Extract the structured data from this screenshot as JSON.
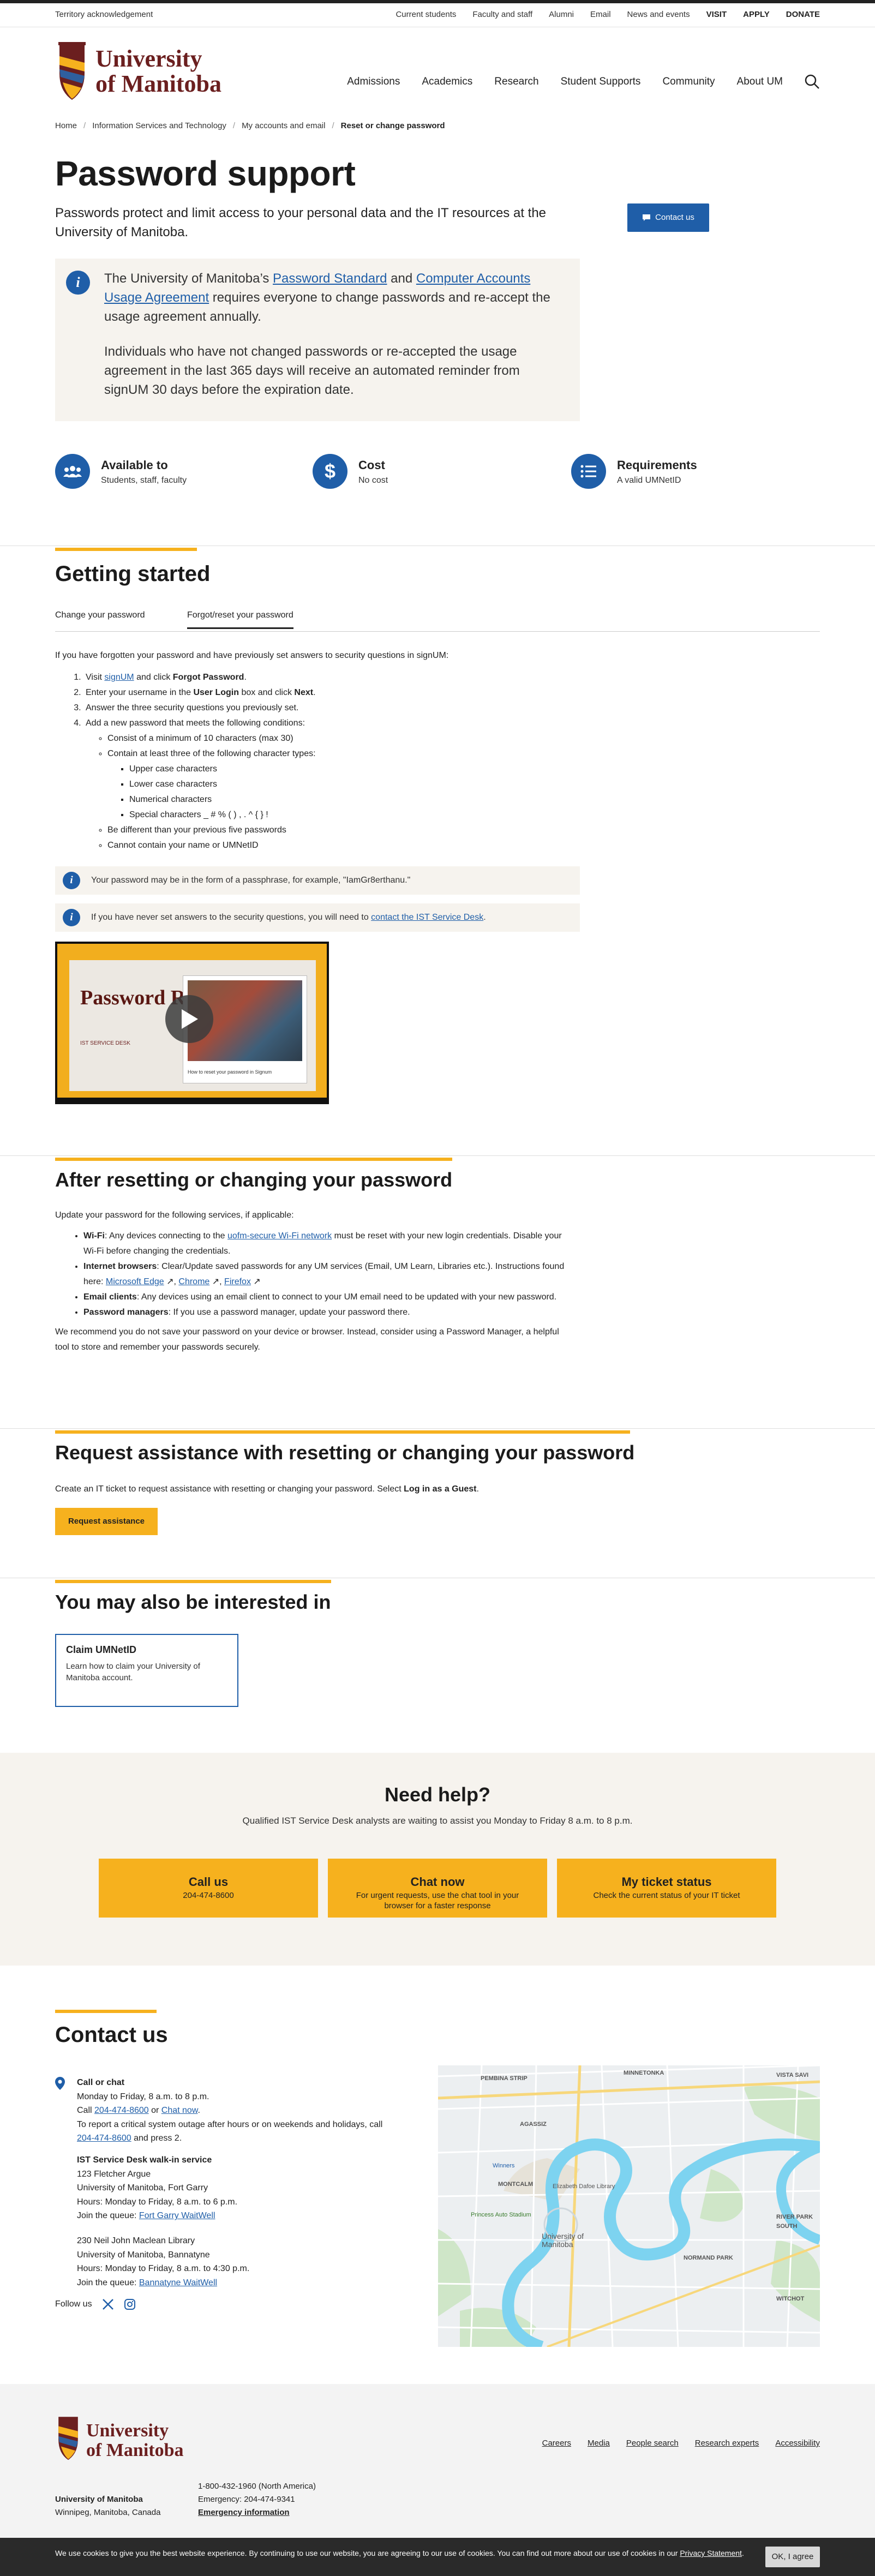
{
  "topbar": {
    "territory": "Territory acknowledgement",
    "links": [
      "Current students",
      "Faculty and staff",
      "Alumni",
      "Email",
      "News and events"
    ],
    "strong_links": [
      "VISIT",
      "APPLY",
      "DONATE"
    ]
  },
  "logo": {
    "line1": "University",
    "line2": "of Manitoba"
  },
  "nav": [
    "Admissions",
    "Academics",
    "Research",
    "Student Supports",
    "Community",
    "About UM"
  ],
  "breadcrumb": [
    "Home",
    "Information Services and Technology",
    "My accounts and email",
    "Reset or change password"
  ],
  "page": {
    "title": "Password support",
    "lead": "Passwords protect and limit access to your personal data and the IT resources at the University of Manitoba.",
    "contact_button": "Contact us"
  },
  "notice": {
    "p1_a": "The University of Manitoba’s ",
    "p1_link1": "Password Standard",
    "p1_b": " and ",
    "p1_link2": "Computer Accounts Usage Agreement",
    "p1_c": " requires everyone to change passwords and re-accept the usage agreement annually.",
    "p2": "Individuals who have not changed passwords or re-accepted the usage agreement in the last 365 days will receive an automated reminder from signUM 30 days before the expiration date."
  },
  "features": [
    {
      "title": "Available to",
      "sub": "Students, staff, faculty",
      "icon": "people-icon"
    },
    {
      "title": "Cost",
      "sub": "No cost",
      "icon": "dollar-icon"
    },
    {
      "title": "Requirements",
      "sub": "A valid UMNetID",
      "icon": "list-icon"
    }
  ],
  "getting_started": {
    "heading": "Getting started",
    "tabs": [
      "Change your password",
      "Forgot/reset your password"
    ],
    "intro": "If you have forgotten your password and have previously set answers to security questions in signUM:",
    "step1_a": "Visit ",
    "step1_link": "signUM",
    "step1_b": " and click ",
    "step1_bold": "Forgot Password",
    "step1_c": ".",
    "step2_a": "Enter your username in the ",
    "step2_bold1": "User Login",
    "step2_b": " box and click ",
    "step2_bold2": "Next",
    "step2_c": ".",
    "step3": "Answer the three security questions you previously set.",
    "step4": "Add a new password that meets the following conditions:",
    "cond1": "Consist of a minimum of 10 characters (max 30)",
    "cond2": "Contain at least three of the following character types:",
    "types": [
      "Upper case characters",
      "Lower case characters",
      "Numerical characters",
      "Special characters _ # % ( ) , . ^ { } !"
    ],
    "cond3": "Be different than your previous five passwords",
    "cond4": "Cannot contain your name or UMNetID",
    "tip1": "Your password may be in the form of a passphrase, for example, \"IamGr8erthanu.\"",
    "tip2_a": "If you have never set answers to the security questions, you will need to ",
    "tip2_link": "contact the IST Service Desk",
    "tip2_b": ".",
    "video_title": "Password Reset",
    "video_sub": "IST SERVICE DESK",
    "video_caption": "How to reset your password in Signum"
  },
  "after": {
    "heading": "After resetting or changing your password",
    "intro": "Update your password for the following services, if applicable:",
    "wifi_label": "Wi-Fi",
    "wifi_a": ": Any devices connecting to the ",
    "wifi_link": "uofm-secure Wi-Fi network",
    "wifi_b": " must be reset with your new login credentials. Disable your Wi-Fi before changing the credentials.",
    "browsers_label": "Internet browsers",
    "browsers_a": ": Clear/Update saved passwords for any UM services (Email, UM Learn, Libraries etc.). Instructions found here: ",
    "browser_links": [
      "Microsoft Edge",
      "Chrome",
      "Firefox"
    ],
    "email_label": "Email clients",
    "email_text": ": Any devices using an email client to connect to your UM email need to be updated with your new password.",
    "pm_label": "Password managers",
    "pm_text": ": If you use a password manager, update your password there.",
    "outro": "We recommend you do not save your password on your device or browser. Instead, consider using a Password Manager, a helpful tool to store and remember your passwords securely."
  },
  "assist": {
    "heading": "Request assistance with resetting or changing your password",
    "text_a": "Create an IT ticket to request assistance with resetting or changing your password. Select ",
    "text_bold": "Log in as a Guest",
    "text_b": ".",
    "button": "Request assistance"
  },
  "interested": {
    "heading": "You may also be interested in",
    "card_title": "Claim UMNetID",
    "card_desc": "Learn how to claim your University of Manitoba account."
  },
  "help": {
    "heading": "Need help?",
    "sub": "Qualified IST Service Desk analysts are waiting to assist you Monday to Friday 8 a.m. to 8 p.m.",
    "buttons": [
      {
        "title": "Call us",
        "sub": "204-474-8600"
      },
      {
        "title": "Chat now",
        "sub": "For urgent requests, use the chat tool in your browser for a faster response"
      },
      {
        "title": "My ticket status",
        "sub": "Check the current status of your IT ticket"
      }
    ]
  },
  "contact": {
    "heading": "Contact us",
    "call_title": "Call or chat",
    "call_hours": "Monday to Friday, 8 a.m. to 8 p.m.",
    "call_a": "Call ",
    "call_phone": "204-474-8600",
    "call_or": " or ",
    "call_chat": "Chat now",
    "call_b": ".",
    "outage": "To report a critical system outage after hours or on weekends and holidays, call",
    "outage_phone": "204-474-8600",
    "outage_b": " and press 2.",
    "walkin_title": "IST Service Desk walk-in service",
    "walkin_addr1": "123 Fletcher Argue",
    "walkin_addr2": "University of Manitoba, Fort Garry",
    "walkin_hours": "Hours: Monday to Friday, 8 a.m. to 6 p.m.",
    "walkin_queue_a": "Join the queue: ",
    "walkin_queue_link": "Fort Garry WaitWell",
    "b_addr1": "230 Neil John Maclean Library",
    "b_addr2": "University of Manitoba, Bannatyne",
    "b_hours": "Hours: Monday to Friday, 8 a.m. to 4:30 p.m.",
    "b_queue_a": "Join the queue: ",
    "b_queue_link": "Bannatyne WaitWell",
    "follow": "Follow us",
    "map_labels": [
      "PEMBINA STRIP",
      "MINNETONKA",
      "VISTA SAVI",
      "AGASSIZ",
      "Winners",
      "MONTCALM",
      "Elizabeth Dafoe Library",
      "Princess Auto Stadium",
      "University of Manitoba",
      "RIVER PARK SOUTH",
      "NORMAND PARK",
      "WITCHOT"
    ]
  },
  "footer": {
    "links": [
      "Careers",
      "Media",
      "People search",
      "Research experts",
      "Accessibility"
    ],
    "addr1": "University of Manitoba",
    "addr2": "Winnipeg, Manitoba, Canada",
    "phone1": "1-800-432-1960 (North America)",
    "phone2": "Emergency: 204-474-9341",
    "phone3": "Emergency information"
  },
  "cookie": {
    "text": "We use cookies to give you the best website experience. By continuing to use our website, you are agreeing to our use of cookies. You can find out more about our use of cookies in our ",
    "link": "Privacy Statement",
    "text_b": ".",
    "button": "OK, I agree"
  },
  "colors": {
    "brand_blue": "#1f5ea8",
    "accent_gold": "#f6b11e",
    "brand_maroon": "#6b1f1f",
    "panel_bg": "#f6f3ee"
  }
}
